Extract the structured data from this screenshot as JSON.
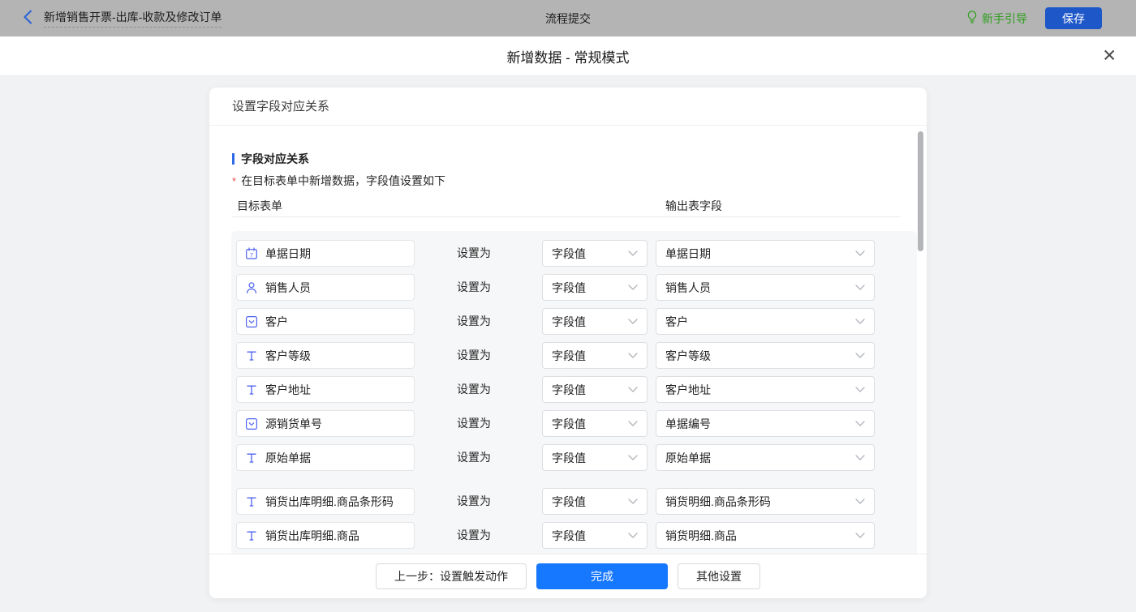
{
  "topbar": {
    "title": "新增销售开票-出库-收款及修改订单",
    "center_title": "流程提交",
    "guide_label": "新手引导",
    "save_label": "保存"
  },
  "modal": {
    "title": "新增数据 - 常规模式",
    "close_glyph": "✕"
  },
  "panel": {
    "header": "设置字段对应关系",
    "section_title": "字段对应关系",
    "required_mark": "*",
    "note": "在目标表单中新增数据，字段值设置如下",
    "columns": {
      "left": "目标表单",
      "right": "输出表字段"
    },
    "set_as": "设置为",
    "groups": [
      {
        "rows": [
          {
            "icon": "calendar",
            "field": "单据日期",
            "method": "字段值",
            "output": "单据日期"
          },
          {
            "icon": "user",
            "field": "销售人员",
            "method": "字段值",
            "output": "销售人员"
          },
          {
            "icon": "select",
            "field": "客户",
            "method": "字段值",
            "output": "客户"
          },
          {
            "icon": "text",
            "field": "客户等级",
            "method": "字段值",
            "output": "客户等级"
          },
          {
            "icon": "text",
            "field": "客户地址",
            "method": "字段值",
            "output": "客户地址"
          },
          {
            "icon": "select",
            "field": "源销货单号",
            "method": "字段值",
            "output": "单据编号"
          },
          {
            "icon": "text",
            "field": "原始单据",
            "method": "字段值",
            "output": "原始单据"
          }
        ]
      },
      {
        "rows": [
          {
            "icon": "text",
            "field": "销货出库明细.商品条形码",
            "method": "字段值",
            "output": "销货明细.商品条形码"
          },
          {
            "icon": "text",
            "field": "销货出库明细.商品",
            "method": "字段值",
            "output": "销货明细.商品"
          }
        ]
      }
    ],
    "footer": {
      "prev": "上一步：设置触发动作",
      "done": "完成",
      "other": "其他设置"
    }
  },
  "colors": {
    "topbar_bg": "#b4b4b4",
    "back_arrow_blue": "#2a62d9",
    "guide_green": "#2f9e1d",
    "save_button_blue": "#1e57c8",
    "done_button_blue": "#1677ff",
    "field_icon_blue": "#4e62ee",
    "section_bar_blue": "#2e6be5",
    "required_red": "#e34d4d"
  }
}
